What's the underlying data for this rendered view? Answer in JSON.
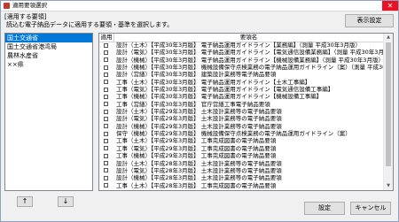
{
  "window": {
    "title": "適用要領選択",
    "close_glyph": "✕"
  },
  "header": {
    "section_label": "[適用する要領]",
    "instruction": "読込む電子納品データに適用する要領・基準を選択します。",
    "display_settings_label": "表示設定"
  },
  "groups": [
    {
      "label": "国土交通省",
      "selected": true
    },
    {
      "label": "国土交通省港湾局",
      "selected": false
    },
    {
      "label": "農林水産省",
      "selected": false
    },
    {
      "label": "××県",
      "selected": false
    }
  ],
  "nav": {
    "up_label": "↑",
    "down_label": "↓"
  },
  "table": {
    "col_apply": "適用",
    "col_name": "要領名",
    "rows": [
      "設計（土木）【平成30年3月版】 電子納品運用ガイドライン【業務編】（測量 平成30年3月版）",
      "設計（電気）【平成30年3月版】 電子納品運用ガイドライン【電気通信設備業務編】（測量 平成30年3月版）",
      "設計（機械）【平成30年3月版】 電子納品運用ガイドライン【機械設備業務編】（測量 平成30年3月版）",
      "設計（機械）【平成30年3月版】 機械設備保守点検業務の電子納品運用ガイドライン（案）（測量 平成30年3...",
      "設計（営繕）【平成30年3月版】 建築設計業務等電子納品要領",
      "工事（土木）【平成30年3月版】 電子納品運用ガイドライン【土木工事編】",
      "工事（電気）【平成30年3月版】 電子納品運用ガイドライン【電気通信設備工事編】",
      "工事（機械）【平成30年3月版】 電子納品運用ガイドライン【機械設備工事編】",
      "工事（営繕）【平成30年3月版】 官庁営繕工事電子納品要領",
      "設計（土木）【平成29年3月版】 土木設計業務等の電子納品要領",
      "設計（電気）【平成29年3月版】 土木設計業務等の電子納品要領",
      "設計（機械）【平成29年3月版】 土木設計業務等の電子納品要領",
      "保守（機械）【平成29年3月版】 機械設備保守点検業務の電子納品運用ガイドライン（案）",
      "工事（土木）【平成29年3月版】 工事完成図書の電子納品要領",
      "工事（電気）【平成29年3月版】 工事完成図書の電子納品要領",
      "工事（機械）【平成29年3月版】 工事完成図書の電子納品要領",
      "設計（土木）【平成28年3月版】 土木設計業務等の電子納品要領",
      "設計（電気）【平成28年3月版】 土木設計業務等の電子納品要領",
      "設計（機械）【平成28年3月版】 土木設計業務等の電子納品要領",
      "工事（土木）【平成28年3月版】 工事完成図書の電子納品要領"
    ]
  },
  "footer": {
    "ok_label": "設定",
    "cancel_label": "キャンセル"
  },
  "colors": {
    "selection": "#0078d7",
    "close": "#e81123"
  }
}
